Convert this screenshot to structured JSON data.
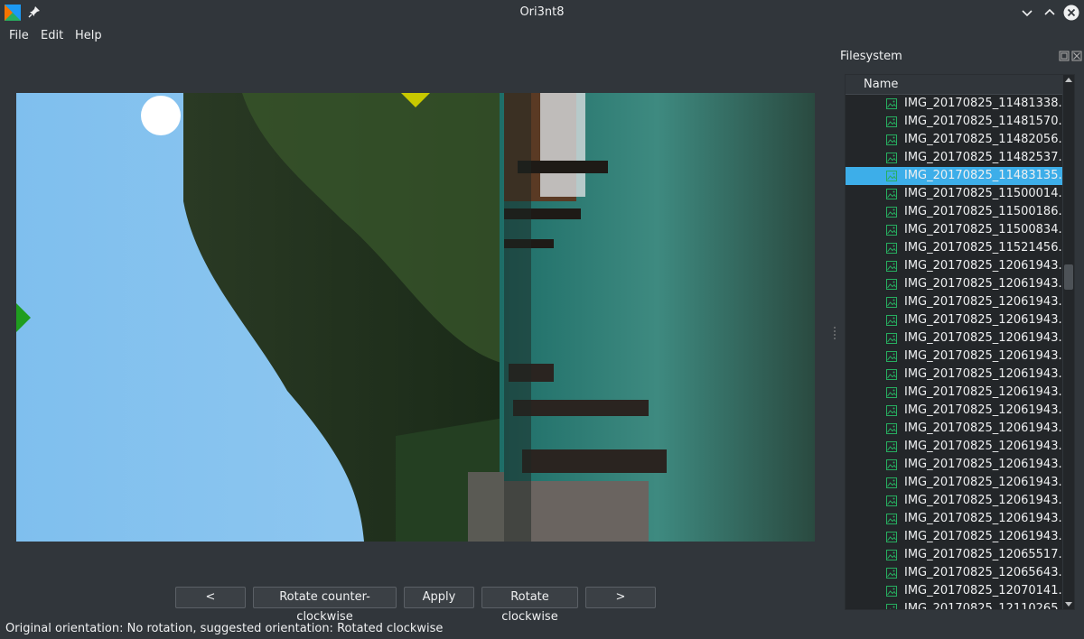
{
  "window": {
    "title": "Ori3nt8"
  },
  "menu": {
    "file": "File",
    "edit": "Edit",
    "help": "Help"
  },
  "buttons": {
    "prev": "<",
    "rotate_ccw": "Rotate counter-clockwise",
    "apply": "Apply",
    "rotate_cw": "Rotate clockwise",
    "next": ">"
  },
  "dock": {
    "title": "Filesystem",
    "column_name": "Name"
  },
  "files": [
    "IMG_20170825_11481338...",
    "IMG_20170825_11481570...",
    "IMG_20170825_11482056...",
    "IMG_20170825_11482537...",
    "IMG_20170825_11483135...",
    "IMG_20170825_11500014...",
    "IMG_20170825_11500186...",
    "IMG_20170825_11500834...",
    "IMG_20170825_11521456...",
    "IMG_20170825_12061943...",
    "IMG_20170825_12061943...",
    "IMG_20170825_12061943...",
    "IMG_20170825_12061943...",
    "IMG_20170825_12061943...",
    "IMG_20170825_12061943...",
    "IMG_20170825_12061943...",
    "IMG_20170825_12061943...",
    "IMG_20170825_12061943...",
    "IMG_20170825_12061943...",
    "IMG_20170825_12061943...",
    "IMG_20170825_12061943...",
    "IMG_20170825_12061943...",
    "IMG_20170825_12061943...",
    "IMG_20170825_12061943...",
    "IMG_20170825_12061943...",
    "IMG_20170825_12065517...",
    "IMG_20170825_12065643...",
    "IMG_20170825_12070141...",
    "IMG_20170825_12110265..."
  ],
  "selected_index": 4,
  "status": "Original orientation: No rotation, suggested orientation: Rotated clockwise",
  "colors": {
    "accent": "#3daee9",
    "marker_top": "#c8c800",
    "marker_left": "#1f9d1f",
    "file_icon": "#27ae60"
  },
  "icons": {
    "app": "app-logo-icon",
    "pin": "pin-icon",
    "minimize": "chevron-down-icon",
    "maximize": "chevron-up-icon",
    "close": "close-icon",
    "file": "image-file-icon"
  }
}
